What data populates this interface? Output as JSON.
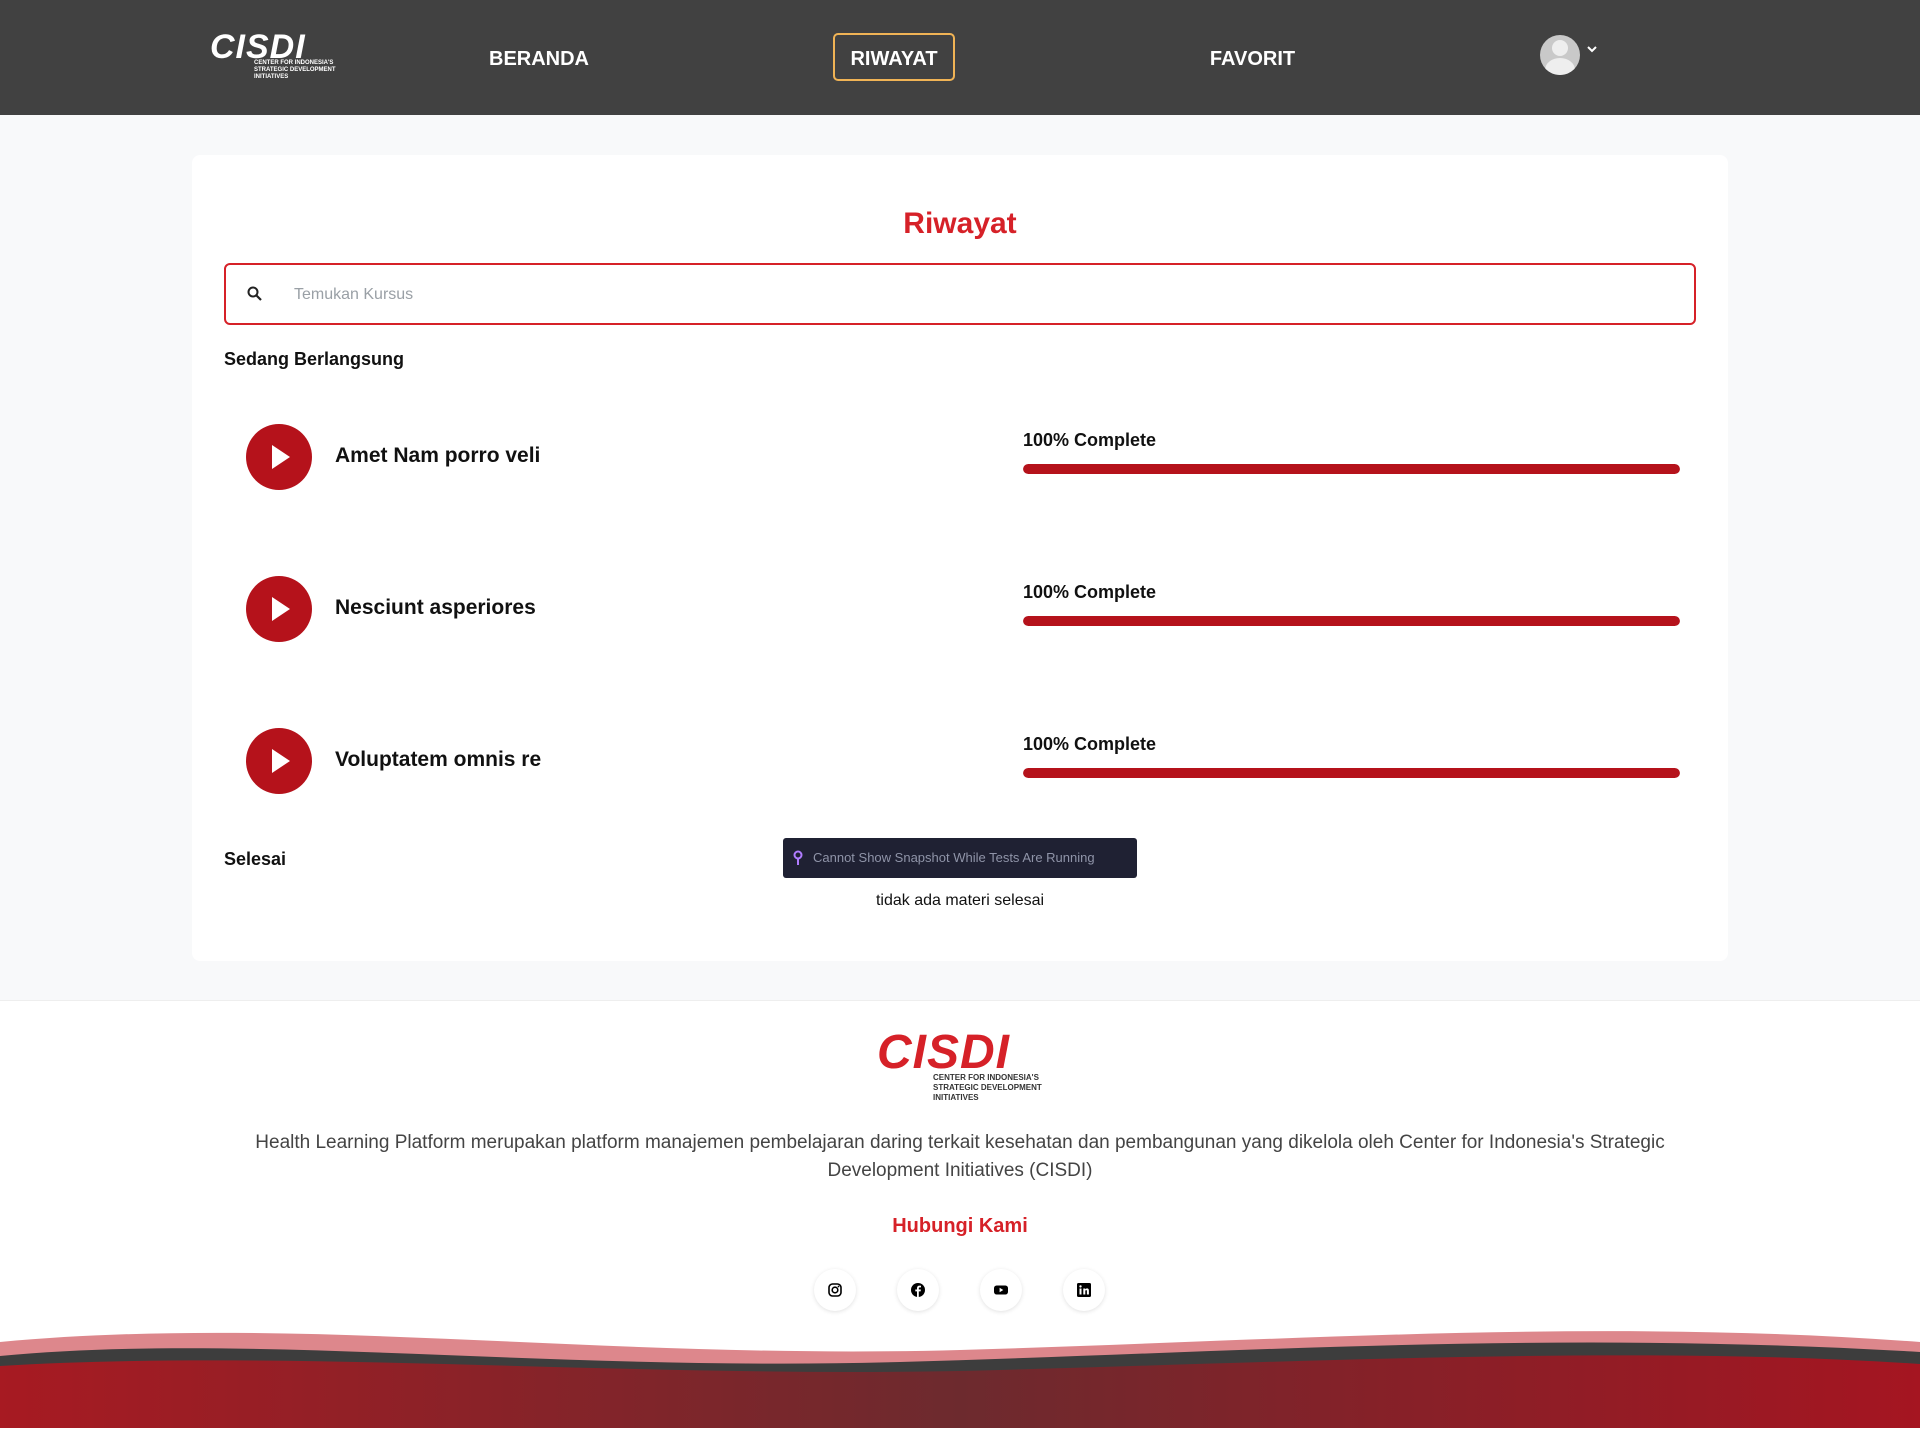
{
  "header": {
    "logo_text": "CISDI",
    "logo_subtext": "CENTER FOR INDONESIA'S STRATEGIC DEVELOPMENT INITIATIVES",
    "nav": [
      {
        "label": "BERANDA",
        "active": false
      },
      {
        "label": "RIWAYAT",
        "active": true
      },
      {
        "label": "FAVORIT",
        "active": false
      }
    ],
    "active_border_color": "#f0b355"
  },
  "main": {
    "title": "Riwayat",
    "search": {
      "placeholder": "Temukan Kursus",
      "value": ""
    },
    "in_progress_label": "Sedang Berlangsung",
    "courses": [
      {
        "title": "Amet Nam porro veli",
        "progress_label": "100% Complete",
        "progress": 1.0
      },
      {
        "title": "Nesciunt asperiores",
        "progress_label": "100% Complete",
        "progress": 1.0
      },
      {
        "title": "Voluptatem omnis re",
        "progress_label": "100% Complete",
        "progress": 1.0
      }
    ],
    "done_label": "Selesai",
    "snapshot_notice": "Cannot Show Snapshot While Tests Are Running",
    "empty_done_text": "tidak ada materi selesai"
  },
  "footer": {
    "logo_text": "CISDI",
    "logo_subtext": "CENTER FOR INDONESIA'S STRATEGIC DEVELOPMENT INITIATIVES",
    "description": "Health Learning Platform merupakan platform manajemen pembelajaran daring terkait kesehatan dan pembangunan yang dikelola oleh Center for Indonesia's Strategic Development Initiatives (CISDI)",
    "contact_title": "Hubungi Kami",
    "social_icons": [
      "instagram-icon",
      "facebook-icon",
      "youtube-icon",
      "linkedin-icon"
    ]
  },
  "colors": {
    "brand_red": "#d62128",
    "progress_red": "#b5121b",
    "header_bg": "#414141"
  }
}
